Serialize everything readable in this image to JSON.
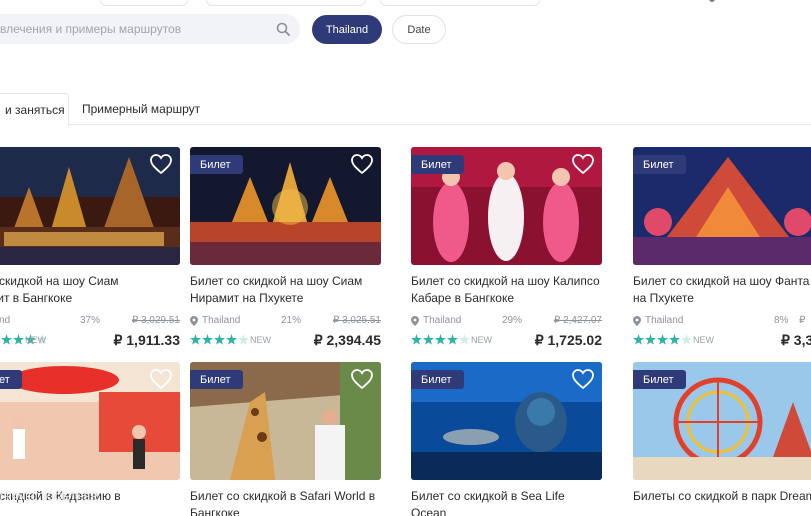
{
  "search": {
    "placeholder": "влечения и примеры маршрутов"
  },
  "filters": {
    "country": "Thailand",
    "date": "Date"
  },
  "tabs": [
    {
      "label": "и заняться"
    },
    {
      "label": "Примерный маршрут"
    }
  ],
  "cards_row1": [
    {
      "badge": "",
      "title": "о скидкой на шоу Сиам\nмит в Бангкоке",
      "location": "iland",
      "discount": "37%",
      "old_price": "₽ 3,029.51",
      "price": "₽ 1,911.33",
      "new": "NEW",
      "rating": 4.5
    },
    {
      "badge": "Билет",
      "title": "Билет со скидкой на шоу Сиам\nНирамит на Пхукете",
      "location": "Thailand",
      "discount": "21%",
      "old_price": "₽ 3,025.51",
      "price": "₽ 2,394.45",
      "new": "NEW",
      "rating": 4.5
    },
    {
      "badge": "Билет",
      "title": "Билет со скидкой на шоу Калипсо\nКабаре в Бангкоке",
      "location": "Thailand",
      "discount": "29%",
      "old_price": "₽ 2,427.07",
      "price": "₽ 1,725.02",
      "new": "NEW",
      "rating": 4.5
    },
    {
      "badge": "Билет",
      "title": "Билет со скидкой на шоу Фанта\nна Пхукете",
      "location": "Thailand",
      "discount": "8%",
      "old_price": "₽",
      "price": "₽ 3,3",
      "new": "NEW",
      "rating": 4.0
    }
  ],
  "cards_row2": [
    {
      "badge": "ет",
      "title": "о скидкой в Кидзанию в"
    },
    {
      "badge": "Билет",
      "title": "Билет со скидкой в Safari World в\nБангкоке"
    },
    {
      "badge": "Билет",
      "title": "Билет со скидкой в Sea Life Ocean\nWorld в Бангкоке"
    },
    {
      "badge": "Билет",
      "title": "Билеты со скидкой в парк Dream"
    }
  ],
  "watermark": "TRAVEL TOGETHER",
  "colors": {
    "accent": "#2f3b78",
    "star": "#2bb3a3"
  }
}
